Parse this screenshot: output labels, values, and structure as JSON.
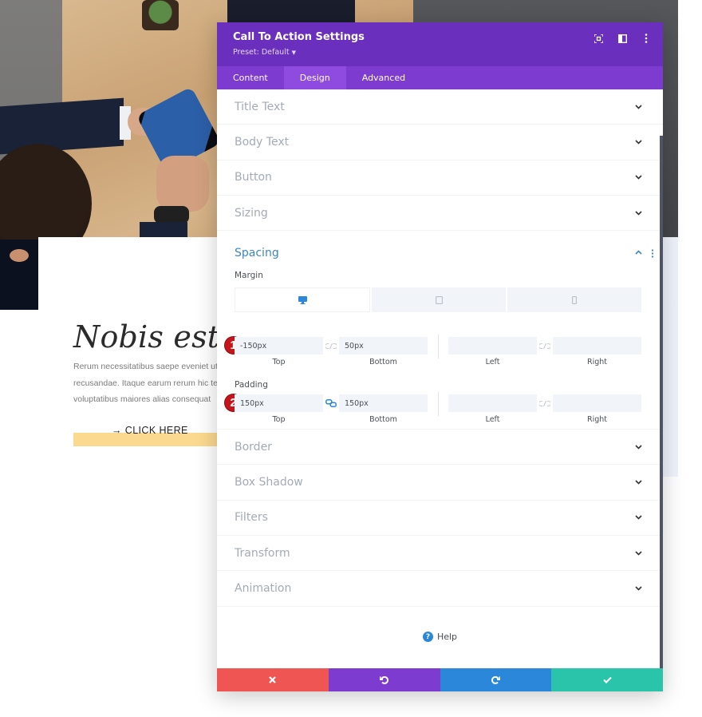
{
  "background_page": {
    "cta": {
      "title": "Nobis est elig",
      "body_lines": [
        "Rerum necessitatibus saepe eveniet ut",
        "recusandae. Itaque earum rerum hic te",
        "voluptatibus maiores alias consequat"
      ],
      "button_label": "→ CLICK HERE",
      "button_color": "#fbd98f"
    }
  },
  "modal": {
    "title": "Call To Action Settings",
    "preset_label": "Preset: Default",
    "header_color": "#6b2fbd",
    "header_icons": [
      "focus-icon",
      "split-view-icon",
      "more-options-icon"
    ],
    "tabs": [
      {
        "label": "Content",
        "active": false
      },
      {
        "label": "Design",
        "active": true
      },
      {
        "label": "Advanced",
        "active": false
      }
    ],
    "sections_before": [
      {
        "label": "Title Text"
      },
      {
        "label": "Body Text"
      },
      {
        "label": "Button"
      },
      {
        "label": "Sizing"
      }
    ],
    "spacing": {
      "label": "Spacing",
      "expanded": true,
      "margin": {
        "label": "Margin",
        "devices": [
          "desktop",
          "tablet",
          "phone"
        ],
        "active_device": "desktop",
        "top": {
          "value": "-150px",
          "label": "Top"
        },
        "bottom": {
          "value": "50px",
          "label": "Bottom"
        },
        "left": {
          "value": "",
          "label": "Left"
        },
        "right": {
          "value": "",
          "label": "Right"
        },
        "top_bottom_linked": false,
        "left_right_linked": false,
        "annotation": "1"
      },
      "padding": {
        "label": "Padding",
        "top": {
          "value": "150px",
          "label": "Top"
        },
        "bottom": {
          "value": "150px",
          "label": "Bottom"
        },
        "left": {
          "value": "",
          "label": "Left"
        },
        "right": {
          "value": "",
          "label": "Right"
        },
        "top_bottom_linked": true,
        "left_right_linked": false,
        "annotation": "2"
      }
    },
    "sections_after": [
      {
        "label": "Border"
      },
      {
        "label": "Box Shadow"
      },
      {
        "label": "Filters"
      },
      {
        "label": "Transform"
      },
      {
        "label": "Animation"
      }
    ],
    "help_label": "Help",
    "footer": {
      "discard_color": "#ef5552",
      "undo_color": "#7d3bcf",
      "redo_color": "#2b87da",
      "save_color": "#29c4a9"
    }
  }
}
